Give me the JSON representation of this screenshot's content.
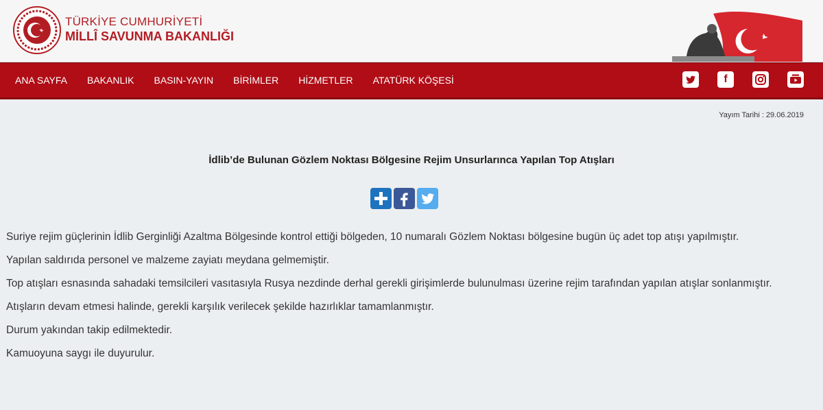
{
  "brand": {
    "line1": "TÜRKİYE CUMHURİYETİ",
    "line2": "MİLLÎ SAVUNMA BAKANLIĞI"
  },
  "nav": {
    "items": [
      {
        "label": "ANA SAYFA"
      },
      {
        "label": "BAKANLIK"
      },
      {
        "label": "BASIN-YAYIN"
      },
      {
        "label": "BİRİMLER"
      },
      {
        "label": "HİZMETLER"
      },
      {
        "label": "ATATÜRK KÖŞESİ"
      }
    ]
  },
  "social": [
    {
      "icon": "twitter-icon"
    },
    {
      "icon": "facebook-icon"
    },
    {
      "icon": "instagram-icon"
    },
    {
      "icon": "youtube-icon"
    }
  ],
  "article": {
    "date": "Yayım Tarihi : 29.06.2019",
    "title": "İdlib’de Bulunan Gözlem Noktası Bölgesine Rejim Unsurlarınca Yapılan Top Atışları",
    "paragraphs": [
      "Suriye rejim güçlerinin İdlib Gerginliği Azaltma Bölgesinde kontrol ettiği bölgeden, 10 numaralı Gözlem Noktası bölgesine bugün üç adet top atışı yapılmıştır.",
      "Yapılan saldırıda personel ve malzeme zayiatı meydana gelmemiştir.",
      "Top atışları esnasında sahadaki temsilcileri vasıtasıyla Rusya nezdinde derhal gerekli girişimlerde bulunulması üzerine rejim tarafından yapılan atışlar sonlanmıştır.",
      "Atışların devam etmesi halinde, gerekli karşılık verilecek şekilde hazırlıklar tamamlanmıştır.",
      "Durum yakından takip edilmektedir.",
      "Kamuoyuna saygı ile duyurulur."
    ]
  },
  "colors": {
    "brand_red": "#b00d16",
    "share_blue": "#1e73be",
    "facebook": "#3b5998",
    "twitter": "#55acee"
  }
}
